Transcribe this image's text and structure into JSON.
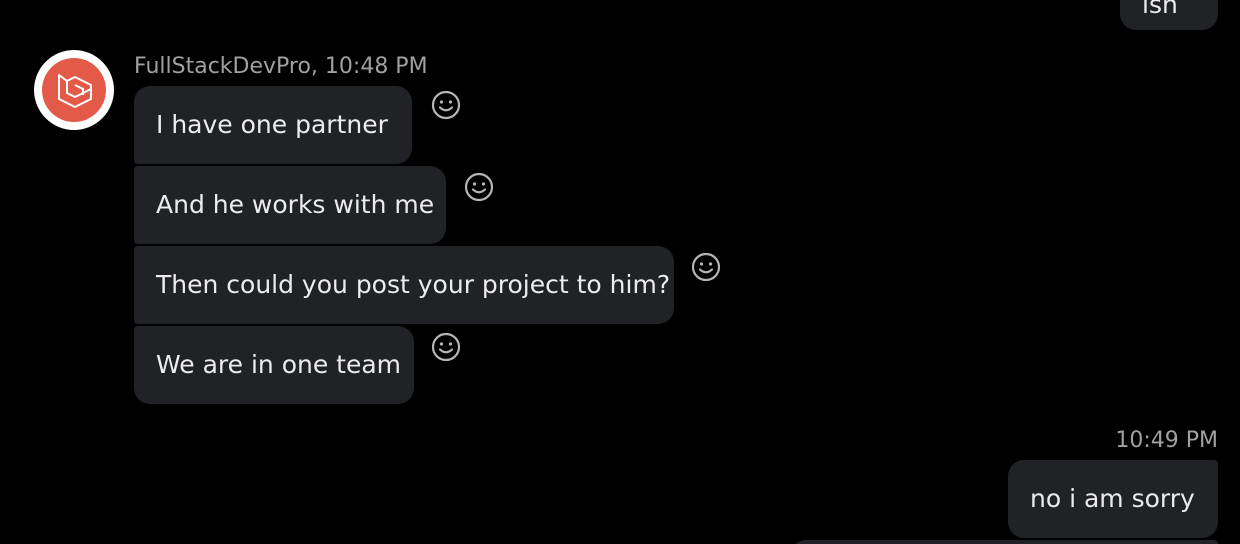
{
  "conversation": {
    "incoming": {
      "sender_name": "FullStackDevPro",
      "sender_time": "10:48 PM",
      "sender_line": "FullStackDevPro, 10:48 PM",
      "avatar_icon": "laravel-logo-icon",
      "messages": [
        {
          "text": "I have one partner"
        },
        {
          "text": "And he works with me"
        },
        {
          "text": "Then could you post your project to him?"
        },
        {
          "text": "We are in one team"
        }
      ]
    },
    "outgoing": {
      "partial_text_top": "ish",
      "time": "10:49 PM",
      "messages": [
        {
          "text": "no i am sorry"
        }
      ]
    },
    "reaction_icon": "smiley-reaction-icon"
  },
  "colors": {
    "background": "#000000",
    "bubble": "#202225",
    "meta_text": "#a0a0a0",
    "avatar_accent": "#e45a48"
  }
}
